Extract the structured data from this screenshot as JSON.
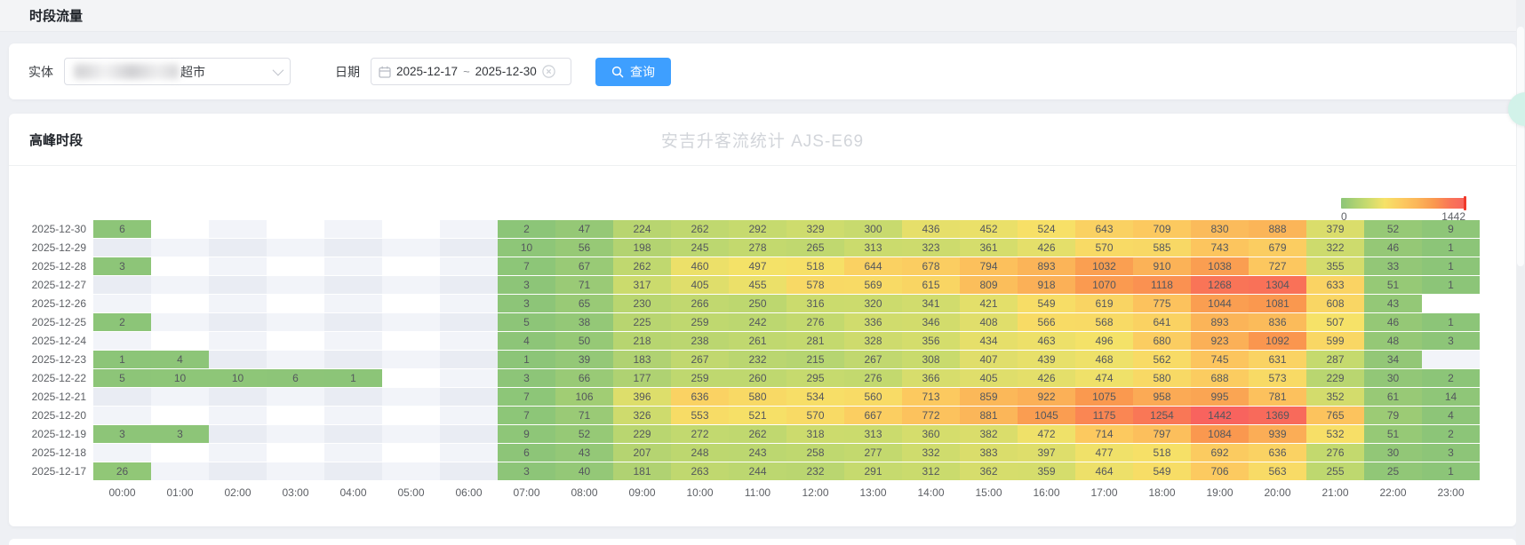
{
  "page": {
    "title": "时段流量"
  },
  "filters": {
    "entity_label": "实体",
    "entity_value": "超市",
    "date_label": "日期",
    "date_start": "2025-12-17",
    "date_separator": "~",
    "date_end": "2025-12-30",
    "query_label": "查询"
  },
  "panel": {
    "title": "高峰时段",
    "chart_title": "安吉升客流统计 AJS-E69"
  },
  "colors": {
    "accent_blue": "#3E9FFF",
    "heat_stops": [
      [
        0,
        "#8CC578"
      ],
      [
        0.2,
        "#C5DA6E"
      ],
      [
        0.35,
        "#F6E268"
      ],
      [
        0.5,
        "#FCC85F"
      ],
      [
        0.62,
        "#FBB458"
      ],
      [
        0.75,
        "#FA984F"
      ],
      [
        0.88,
        "#F97457"
      ],
      [
        1,
        "#F8635E"
      ]
    ],
    "empty_shades": [
      "#FFFFFF",
      "#F2F4F9",
      "#E9ECF3"
    ]
  },
  "chart_data": {
    "type": "heatmap",
    "title": "安吉升客流统计 AJS-E69",
    "xlabel": "",
    "ylabel": "",
    "legend": {
      "min": 0,
      "max": 1442,
      "position": "top-right",
      "orient": "horizontal"
    },
    "x_labels": [
      "00:00",
      "01:00",
      "02:00",
      "03:00",
      "04:00",
      "05:00",
      "06:00",
      "07:00",
      "08:00",
      "09:00",
      "10:00",
      "11:00",
      "12:00",
      "13:00",
      "14:00",
      "15:00",
      "16:00",
      "17:00",
      "18:00",
      "19:00",
      "20:00",
      "21:00",
      "22:00",
      "23:00"
    ],
    "y_labels": [
      "2025-12-30",
      "2025-12-29",
      "2025-12-28",
      "2025-12-27",
      "2025-12-26",
      "2025-12-25",
      "2025-12-24",
      "2025-12-23",
      "2025-12-22",
      "2025-12-21",
      "2025-12-20",
      "2025-12-19",
      "2025-12-18",
      "2025-12-17"
    ],
    "rows": [
      [
        6,
        null,
        null,
        null,
        null,
        null,
        null,
        2,
        47,
        224,
        262,
        292,
        329,
        300,
        436,
        452,
        524,
        643,
        709,
        830,
        888,
        379,
        52,
        9
      ],
      [
        null,
        null,
        null,
        null,
        null,
        null,
        null,
        10,
        56,
        198,
        245,
        278,
        265,
        313,
        323,
        361,
        426,
        570,
        585,
        743,
        679,
        322,
        46,
        1
      ],
      [
        3,
        null,
        null,
        null,
        null,
        null,
        null,
        7,
        67,
        262,
        460,
        497,
        518,
        644,
        678,
        794,
        893,
        1032,
        910,
        1038,
        727,
        355,
        33,
        1
      ],
      [
        null,
        null,
        null,
        null,
        null,
        null,
        null,
        3,
        71,
        317,
        405,
        455,
        578,
        569,
        615,
        809,
        918,
        1070,
        1118,
        1268,
        1304,
        633,
        51,
        1
      ],
      [
        null,
        null,
        null,
        null,
        null,
        null,
        null,
        3,
        65,
        230,
        266,
        250,
        316,
        320,
        341,
        421,
        549,
        619,
        775,
        1044,
        1081,
        608,
        43,
        null
      ],
      [
        2,
        null,
        null,
        null,
        null,
        null,
        null,
        5,
        38,
        225,
        259,
        242,
        276,
        336,
        346,
        408,
        566,
        568,
        641,
        893,
        836,
        507,
        46,
        1
      ],
      [
        null,
        null,
        null,
        null,
        null,
        null,
        null,
        4,
        50,
        218,
        238,
        261,
        281,
        328,
        356,
        434,
        463,
        496,
        680,
        923,
        1092,
        599,
        48,
        3
      ],
      [
        1,
        4,
        null,
        null,
        null,
        null,
        null,
        1,
        39,
        183,
        267,
        232,
        215,
        267,
        308,
        407,
        439,
        468,
        562,
        745,
        631,
        287,
        34,
        null
      ],
      [
        5,
        10,
        10,
        6,
        1,
        null,
        null,
        3,
        66,
        177,
        259,
        260,
        295,
        276,
        366,
        405,
        426,
        474,
        580,
        688,
        573,
        229,
        30,
        2
      ],
      [
        null,
        null,
        null,
        null,
        null,
        null,
        null,
        7,
        106,
        396,
        636,
        580,
        534,
        560,
        713,
        859,
        922,
        1075,
        958,
        995,
        781,
        352,
        61,
        14
      ],
      [
        null,
        null,
        null,
        null,
        null,
        null,
        null,
        7,
        71,
        326,
        553,
        521,
        570,
        667,
        772,
        881,
        1045,
        1175,
        1254,
        1442,
        1369,
        765,
        79,
        4
      ],
      [
        3,
        3,
        null,
        null,
        null,
        null,
        null,
        9,
        52,
        229,
        272,
        262,
        318,
        313,
        360,
        382,
        472,
        714,
        797,
        1084,
        939,
        532,
        51,
        2
      ],
      [
        null,
        null,
        null,
        null,
        null,
        null,
        null,
        6,
        43,
        207,
        248,
        243,
        258,
        277,
        332,
        383,
        397,
        477,
        518,
        692,
        636,
        276,
        30,
        3
      ],
      [
        26,
        null,
        null,
        null,
        null,
        null,
        null,
        3,
        40,
        181,
        263,
        244,
        232,
        291,
        312,
        362,
        359,
        464,
        549,
        706,
        563,
        255,
        25,
        1
      ]
    ]
  }
}
